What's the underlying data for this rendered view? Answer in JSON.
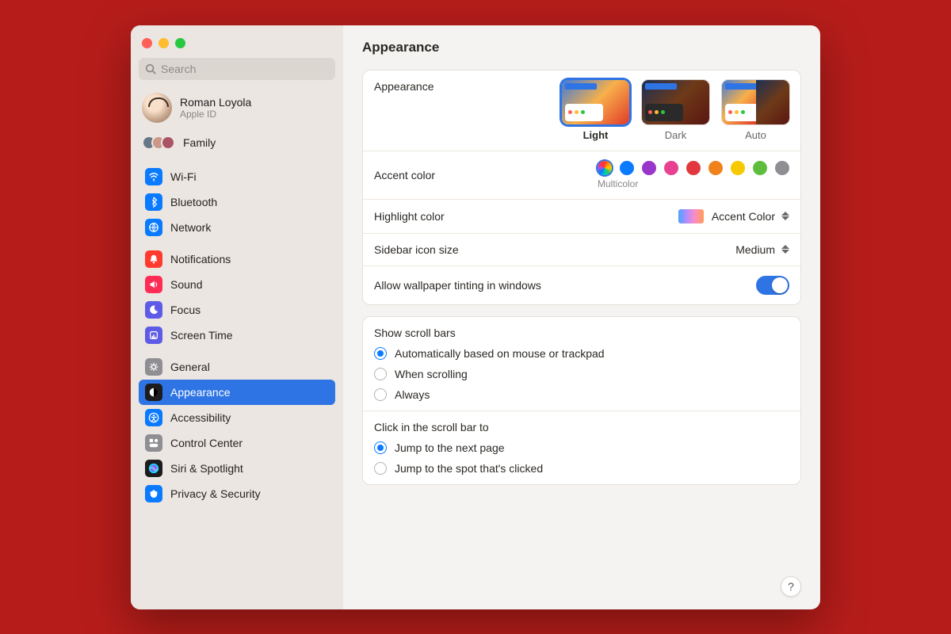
{
  "search": {
    "placeholder": "Search"
  },
  "profile": {
    "name": "Roman Loyola",
    "sub": "Apple ID"
  },
  "family": {
    "label": "Family"
  },
  "sidebar_groups": [
    [
      {
        "id": "wifi",
        "label": "Wi-Fi",
        "color": "#0a7aff"
      },
      {
        "id": "bluetooth",
        "label": "Bluetooth",
        "color": "#0a7aff"
      },
      {
        "id": "network",
        "label": "Network",
        "color": "#0a7aff"
      }
    ],
    [
      {
        "id": "notifications",
        "label": "Notifications",
        "color": "#ff3b30"
      },
      {
        "id": "sound",
        "label": "Sound",
        "color": "#ff2d55"
      },
      {
        "id": "focus",
        "label": "Focus",
        "color": "#5e5ce6"
      },
      {
        "id": "screentime",
        "label": "Screen Time",
        "color": "#5e5ce6"
      }
    ],
    [
      {
        "id": "general",
        "label": "General",
        "color": "#8e8e93"
      },
      {
        "id": "appearance",
        "label": "Appearance",
        "color": "#1c1c1e",
        "selected": true
      },
      {
        "id": "accessibility",
        "label": "Accessibility",
        "color": "#0a7aff"
      },
      {
        "id": "controlcenter",
        "label": "Control Center",
        "color": "#8e8e93"
      },
      {
        "id": "siri",
        "label": "Siri & Spotlight",
        "color": "#1c1c1e"
      },
      {
        "id": "privacy",
        "label": "Privacy & Security",
        "color": "#0a7aff"
      }
    ]
  ],
  "page": {
    "title": "Appearance",
    "appearance_label": "Appearance",
    "options": [
      {
        "label": "Light",
        "selected": true
      },
      {
        "label": "Dark"
      },
      {
        "label": "Auto"
      }
    ],
    "accent_label": "Accent color",
    "accent_caption": "Multicolor",
    "accent_colors": [
      "multi",
      "blue",
      "purple",
      "pink",
      "red",
      "orange",
      "yellow",
      "green",
      "gray"
    ],
    "highlight_label": "Highlight color",
    "highlight_value": "Accent Color",
    "sidebar_size_label": "Sidebar icon size",
    "sidebar_size_value": "Medium",
    "tinting_label": "Allow wallpaper tinting in windows",
    "tinting_on": true,
    "scroll_title": "Show scroll bars",
    "scroll_opts": [
      {
        "label": "Automatically based on mouse or trackpad",
        "checked": true
      },
      {
        "label": "When scrolling"
      },
      {
        "label": "Always"
      }
    ],
    "click_title": "Click in the scroll bar to",
    "click_opts": [
      {
        "label": "Jump to the next page",
        "checked": true
      },
      {
        "label": "Jump to the spot that's clicked"
      }
    ]
  }
}
